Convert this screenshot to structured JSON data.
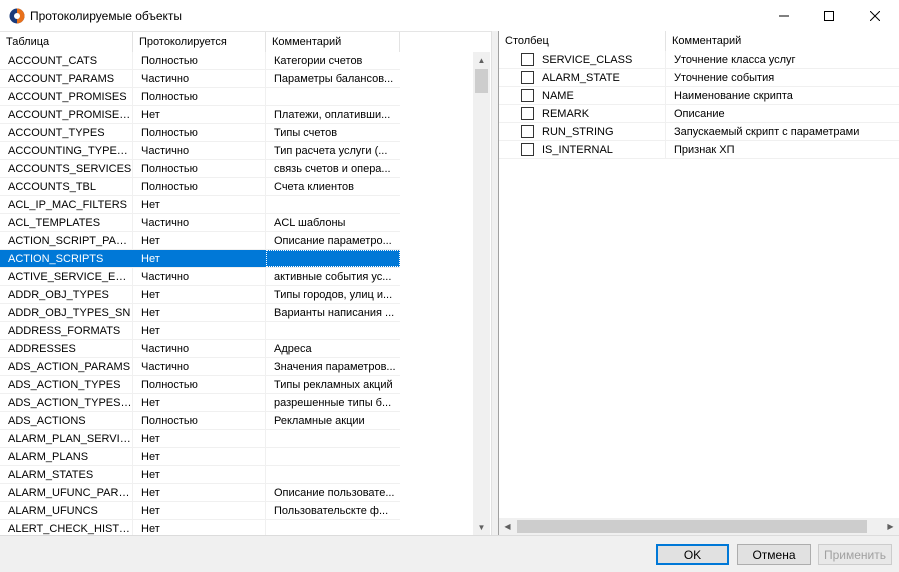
{
  "window": {
    "title": "Протоколируемые объекты"
  },
  "left_grid": {
    "columns": [
      "Таблица",
      "Протоколируется",
      "Комментарий"
    ],
    "rows": [
      {
        "table": "ACCOUNT_CATS",
        "logged": "Полностью",
        "comment": "Категории счетов"
      },
      {
        "table": "ACCOUNT_PARAMS",
        "logged": "Частично",
        "comment": "Параметры балансов..."
      },
      {
        "table": "ACCOUNT_PROMISES",
        "logged": "Полностью",
        "comment": ""
      },
      {
        "table": "ACCOUNT_PROMISES...",
        "logged": "Нет",
        "comment": "Платежи, оплативши..."
      },
      {
        "table": "ACCOUNT_TYPES",
        "logged": "Полностью",
        "comment": "Типы счетов"
      },
      {
        "table": "ACCOUNTING_TYPES_...",
        "logged": "Частично",
        "comment": "Тип расчета услуги (..."
      },
      {
        "table": "ACCOUNTS_SERVICES",
        "logged": "Полностью",
        "comment": "связь счетов и опера..."
      },
      {
        "table": "ACCOUNTS_TBL",
        "logged": "Полностью",
        "comment": "Счета клиентов"
      },
      {
        "table": "ACL_IP_MAC_FILTERS",
        "logged": "Нет",
        "comment": ""
      },
      {
        "table": "ACL_TEMPLATES",
        "logged": "Частично",
        "comment": "ACL шаблоны"
      },
      {
        "table": "ACTION_SCRIPT_PAR...",
        "logged": "Нет",
        "comment": "Описание параметро..."
      },
      {
        "table": "ACTION_SCRIPTS",
        "logged": "Нет",
        "comment": ""
      },
      {
        "table": "ACTIVE_SERVICE_EVE...",
        "logged": "Частично",
        "comment": "активные события ус..."
      },
      {
        "table": "ADDR_OBJ_TYPES",
        "logged": "Нет",
        "comment": "Типы городов, улиц и..."
      },
      {
        "table": "ADDR_OBJ_TYPES_SN",
        "logged": "Нет",
        "comment": "Варианты написания ..."
      },
      {
        "table": "ADDRESS_FORMATS",
        "logged": "Нет",
        "comment": ""
      },
      {
        "table": "ADDRESSES",
        "logged": "Частично",
        "comment": "Адреса"
      },
      {
        "table": "ADS_ACTION_PARAMS",
        "logged": "Частично",
        "comment": "Значения параметров..."
      },
      {
        "table": "ADS_ACTION_TYPES",
        "logged": "Полностью",
        "comment": "Типы рекламных акций"
      },
      {
        "table": "ADS_ACTION_TYPES_...",
        "logged": "Нет",
        "comment": "разрешенные типы б..."
      },
      {
        "table": "ADS_ACTIONS",
        "logged": "Полностью",
        "comment": "Рекламные акции"
      },
      {
        "table": "ALARM_PLAN_SERVIC...",
        "logged": "Нет",
        "comment": ""
      },
      {
        "table": "ALARM_PLANS",
        "logged": "Нет",
        "comment": ""
      },
      {
        "table": "ALARM_STATES",
        "logged": "Нет",
        "comment": ""
      },
      {
        "table": "ALARM_UFUNC_PARA...",
        "logged": "Нет",
        "comment": "Описание пользовате..."
      },
      {
        "table": "ALARM_UFUNCS",
        "logged": "Нет",
        "comment": "Пользовательскте ф..."
      },
      {
        "table": "ALERT_CHECK_HISTORY",
        "logged": "Нет",
        "comment": ""
      }
    ],
    "selected_index": 11
  },
  "right_grid": {
    "columns": [
      "Столбец",
      "Комментарий"
    ],
    "rows": [
      {
        "column": "SERVICE_CLASS",
        "comment": "Уточнение класса услуг",
        "checked": false
      },
      {
        "column": "ALARM_STATE",
        "comment": "Уточнение события",
        "checked": false
      },
      {
        "column": "NAME",
        "comment": "Наименование скрипта",
        "checked": false
      },
      {
        "column": "REMARK",
        "comment": "Описание",
        "checked": false
      },
      {
        "column": "RUN_STRING",
        "comment": "Запускаемый скрипт с параметрами",
        "checked": false
      },
      {
        "column": "IS_INTERNAL",
        "comment": "Признак ХП",
        "checked": false
      }
    ]
  },
  "buttons": {
    "ok": "OK",
    "cancel": "Отмена",
    "apply": "Применить"
  },
  "colors": {
    "selection": "#0078d7",
    "accent": "#0078d7"
  }
}
